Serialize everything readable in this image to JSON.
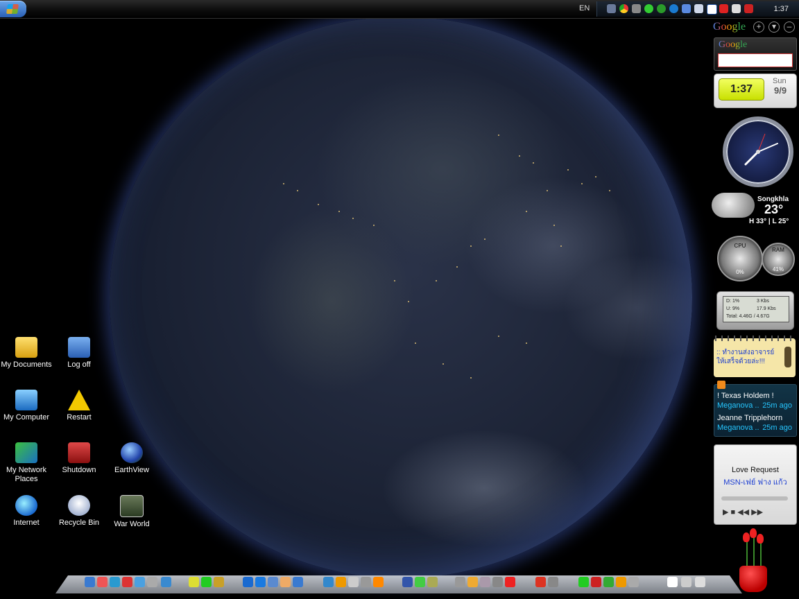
{
  "taskbar": {
    "language": "EN",
    "clock": "1:37",
    "tray_icons": [
      "network-icon",
      "chrome-icon",
      "app-icon",
      "messenger-icon",
      "utorrent-icon",
      "download-icon",
      "monitor-icon",
      "display-icon",
      "app-icon",
      "antivirus-icon",
      "volume-icon",
      "security-icon"
    ]
  },
  "sidebar": {
    "header_logo": "Google",
    "add_label": "+",
    "menu_label": "▾",
    "minimize_label": "–",
    "search_logo": "Google",
    "search_placeholder": ""
  },
  "date_clock": {
    "time": "1:37",
    "day": "Sun",
    "date": "9/9"
  },
  "weather": {
    "city": "Songkhla",
    "temperature": "23°",
    "hilo": "H 33° | L 25°"
  },
  "cpu_meter": {
    "cpu_label": "CPU",
    "cpu_value": "0%",
    "ram_label": "RAM",
    "ram_value": "41%"
  },
  "network_meter": {
    "row1_left": "D: 1%",
    "row1_right": "3 Kbs",
    "row2_left": "U: 9%",
    "row2_right": "17.9 Kbs",
    "total": "Total: 4.46G / 4.67G"
  },
  "notes": {
    "text": ":: ทำงานส่งอาจารย์ ให้เสร็จด้วยล่ะ!!!"
  },
  "feeds": {
    "items": [
      {
        "title": "! Texas Holdem !",
        "source": "Meganova ..",
        "time": "25m ago"
      },
      {
        "title": "Jeanne Tripplehorn",
        "source": "Meganova ..",
        "time": "25m ago"
      }
    ]
  },
  "messenger": {
    "title": "Love Request",
    "from": "MSN-เฟย์ ฟาง แก้ว",
    "controls": "▶ ■ ◀◀ ▶▶"
  },
  "desktop_icons": [
    {
      "label": "My Documents"
    },
    {
      "label": "Log off"
    },
    {
      "label": "My Computer"
    },
    {
      "label": "Restart"
    },
    {
      "label": "My Network Places"
    },
    {
      "label": "Shutdown"
    },
    {
      "label": "EarthView"
    },
    {
      "label": "Internet"
    },
    {
      "label": "Recycle Bin"
    },
    {
      "label": "War World"
    }
  ],
  "colors": {
    "accent_blue": "#26c6ff",
    "clock_green": "#d4ee10",
    "note_yellow": "#f5e6a8",
    "earth_rim": "#3a56b0"
  }
}
